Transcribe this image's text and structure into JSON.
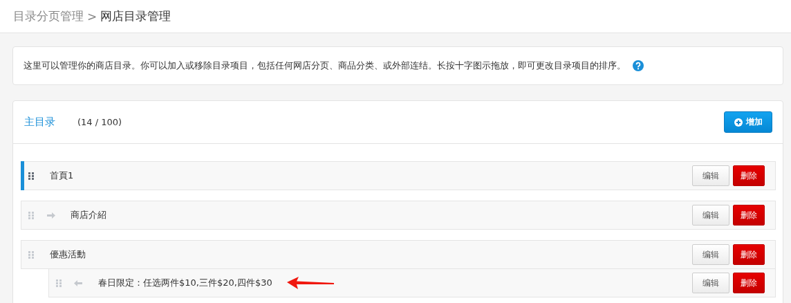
{
  "breadcrumb": {
    "parent": "目录分页管理",
    "separator": ">",
    "current": "网店目录管理"
  },
  "info": {
    "text": "这里可以管理你的商店目录。你可以加入或移除目录项目，包括任何网店分页、商品分类、或外部连结。长按十字图示拖放，即可更改目录项目的排序。"
  },
  "menu": {
    "title": "主目录",
    "count": "(14 / 100)",
    "add_button": "增加",
    "items": [
      {
        "label": "首頁1",
        "kind": "plain",
        "selected": true,
        "edit": "编辑",
        "delete": "删除"
      },
      {
        "label": "商店介紹",
        "kind": "forward",
        "selected": false,
        "edit": "编辑",
        "delete": "删除"
      },
      {
        "label": "優惠活動",
        "kind": "plain",
        "selected": false,
        "edit": "编辑",
        "delete": "删除",
        "children": [
          {
            "label": "春日限定：任选两件$10,三件$20,四件$30",
            "kind": "back",
            "selected": false,
            "edit": "编辑",
            "delete": "删除"
          }
        ]
      }
    ]
  }
}
